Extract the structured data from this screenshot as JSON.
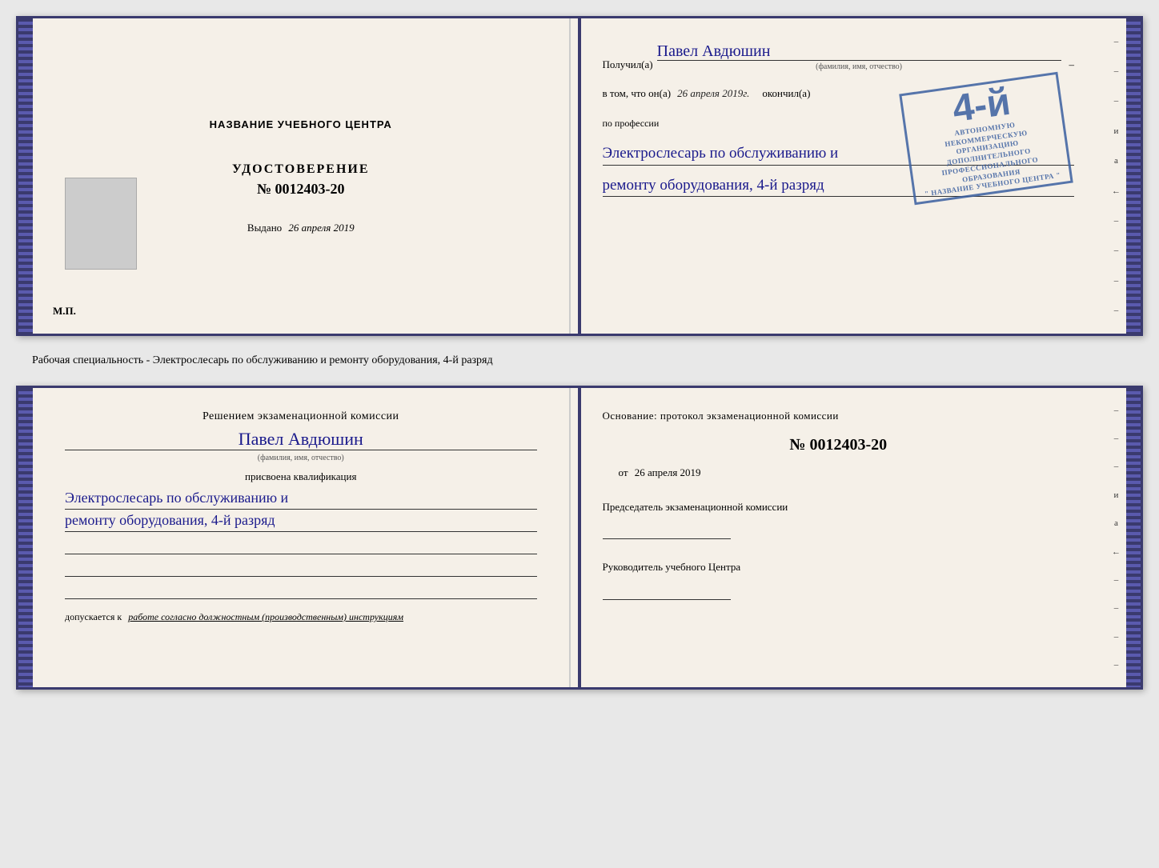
{
  "topBook": {
    "leftPage": {
      "title": "НАЗВАНИЕ УЧЕБНОГО ЦЕНТРА",
      "certLabel": "УДОСТОВЕРЕНИЕ",
      "certNumber": "№ 0012403-20",
      "issuedLabel": "Выдано",
      "issuedDate": "26 апреля 2019",
      "mpLabel": "М.П."
    },
    "rightPage": {
      "receivedLabel": "Получил(а)",
      "recipientName": "Павел Авдюшин",
      "namePlaceholder": "(фамилия, имя, отчество)",
      "tomLabel": "в том, что он(а)",
      "completedDate": "26 апреля 2019г.",
      "completedLabel": "окончил(а)",
      "stamp": {
        "grade": "4-й",
        "line1": "АВТОНОМНУЮ НЕКОММЕРЧЕСКУЮ ОРГАНИЗАЦИЮ",
        "line2": "ДОПОЛНИТЕЛЬНОГО ПРОФЕССИОНАЛЬНОГО ОБРАЗОВАНИЯ",
        "line3": "\" НАЗВАНИЕ УЧЕБНОГО ЦЕНТРА \""
      },
      "professionLabel": "по профессии",
      "professionLine1": "Электрослесарь по обслуживанию и",
      "professionLine2": "ремонту оборудования, 4-й разряд"
    }
  },
  "middleText": "Рабочая специальность - Электрослесарь по обслуживанию и ремонту оборудования, 4-й разряд",
  "bottomBook": {
    "leftPage": {
      "decisionTitle": "Решением экзаменационной комиссии",
      "personName": "Павел Авдюшин",
      "namePlaceholder": "(фамилия, имя, отчество)",
      "assignedLabel": "присвоена квалификация",
      "qualLine1": "Электрослесарь по обслуживанию и",
      "qualLine2": "ремонту оборудования, 4-й разряд",
      "allowedLabel": "допускается к",
      "allowedText": "работе согласно должностным (производственным) инструкциям"
    },
    "rightPage": {
      "basisLabel": "Основание: протокол экзаменационной комиссии",
      "protocolNumber": "№ 0012403-20",
      "fromLabel": "от",
      "fromDate": "26 апреля 2019",
      "chairmanLabel": "Председатель экзаменационной комиссии",
      "directorLabel": "Руководитель учебного Центра"
    }
  },
  "edgeMarks": {
    "dashes": [
      "-",
      "-",
      "-",
      "и",
      "а",
      "←",
      "-",
      "-",
      "-",
      "-"
    ],
    "dashes2": [
      "-",
      "-",
      "-",
      "и",
      "а",
      "←",
      "-",
      "-",
      "-",
      "-"
    ]
  }
}
